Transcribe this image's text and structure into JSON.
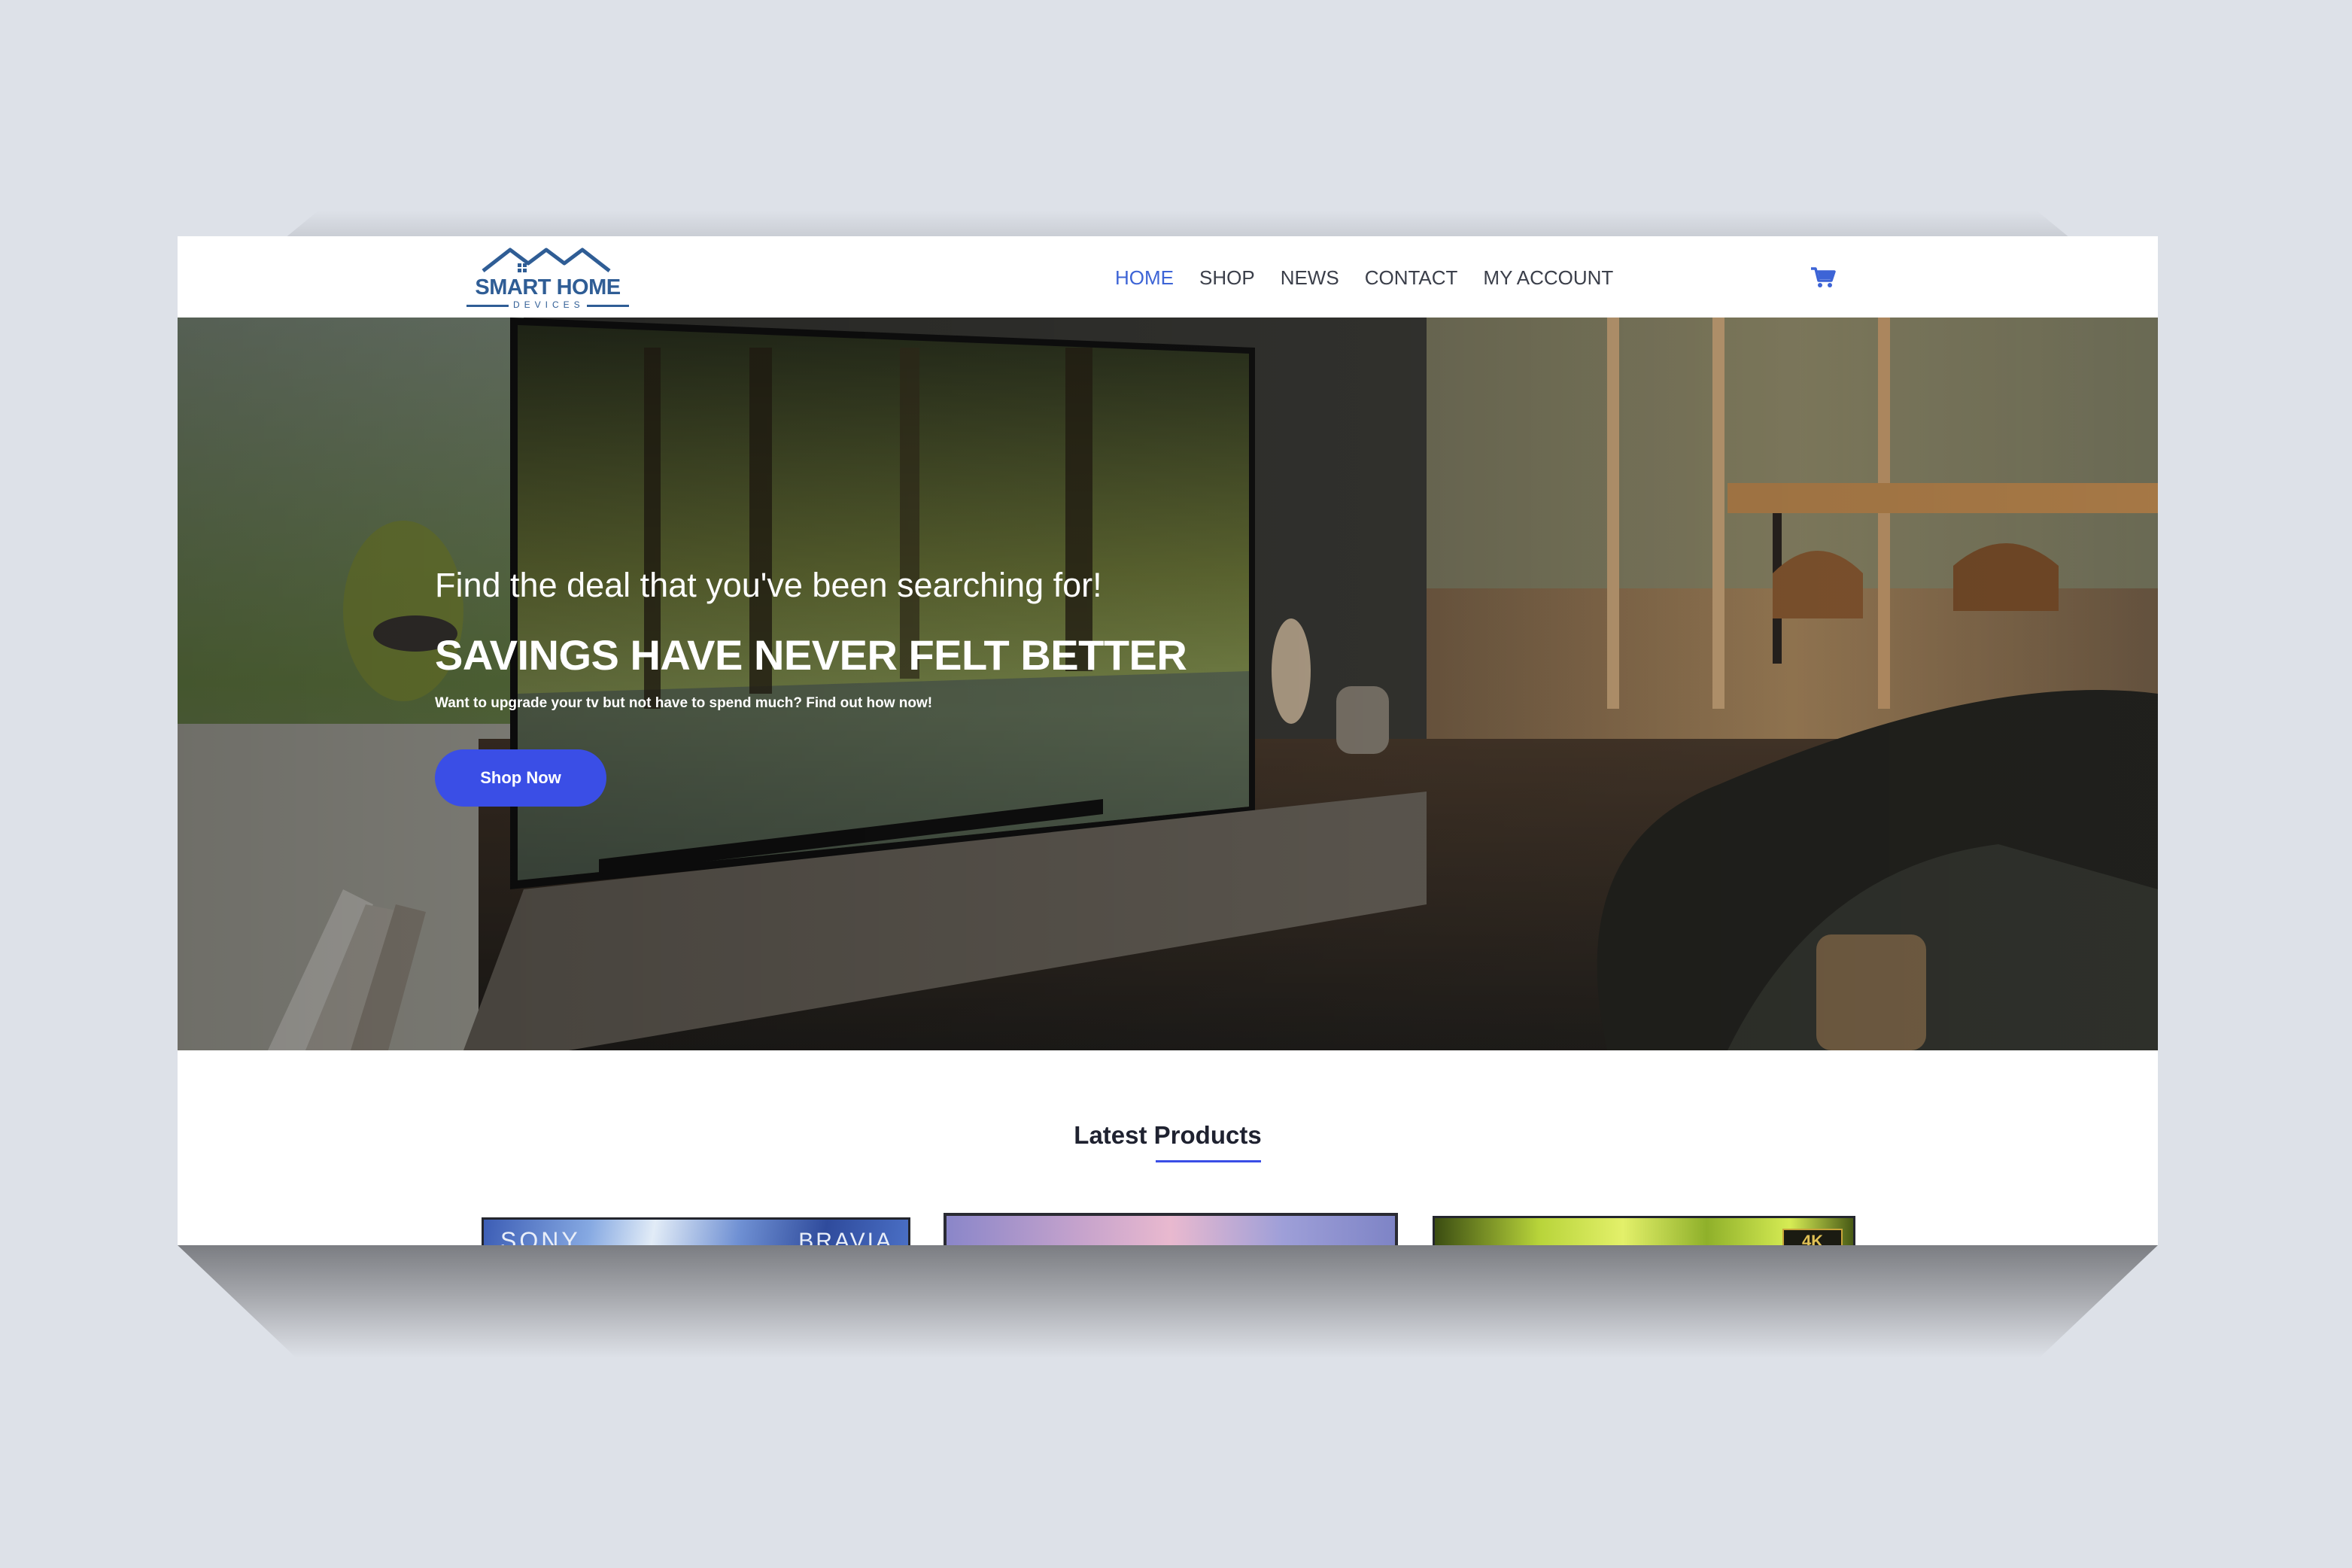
{
  "brand": {
    "logo_text": "SMART HOME",
    "logo_subtext": "DEVICES"
  },
  "nav": {
    "items": [
      {
        "label": "HOME",
        "active": true
      },
      {
        "label": "SHOP",
        "active": false
      },
      {
        "label": "NEWS",
        "active": false
      },
      {
        "label": "CONTACT",
        "active": false
      },
      {
        "label": "MY ACCOUNT",
        "active": false
      }
    ],
    "cart_icon": "shopping-cart-icon"
  },
  "hero": {
    "kicker": "Find the deal that you've been searching for!",
    "title": "SAVINGS HAVE NEVER FELT BETTER",
    "subtitle": "Want to upgrade your tv but not have to spend much? Find out how now!",
    "button_label": "Shop Now"
  },
  "latest": {
    "title": "Latest Products",
    "products": [
      {
        "brand_left": "SONY",
        "brand_right": "BRAVIA"
      },
      {},
      {
        "badge": "4K"
      }
    ]
  },
  "colors": {
    "accent": "#3d64d6",
    "button": "#3a4ee6",
    "logo": "#2f5d95",
    "backdrop": "#dde1e8"
  }
}
